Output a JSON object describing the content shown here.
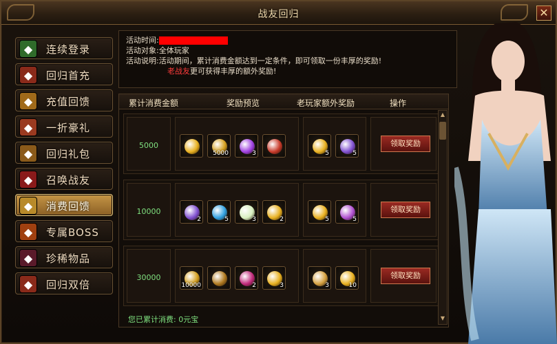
{
  "window": {
    "title": "战友回归",
    "close_label": "✕"
  },
  "sidebar": {
    "items": [
      {
        "label": "连续登录",
        "icon": "tree-icon",
        "color": "#2f6b2a"
      },
      {
        "label": "回归首充",
        "icon": "chest-icon",
        "color": "#8a2a1a"
      },
      {
        "label": "充值回馈",
        "icon": "gold-bag-icon",
        "color": "#a06a1a"
      },
      {
        "label": "一折豪礼",
        "icon": "gift-icon",
        "color": "#9a3a20"
      },
      {
        "label": "回归礼包",
        "icon": "treasure-icon",
        "color": "#8a5a1a"
      },
      {
        "label": "召唤战友",
        "icon": "banner-icon",
        "color": "#8a1a1a"
      },
      {
        "label": "消费回馈",
        "icon": "gold-ingot-icon",
        "color": "#b88a2a",
        "active": true
      },
      {
        "label": "专属BOSS",
        "icon": "boss-icon",
        "color": "#a04010"
      },
      {
        "label": "珍稀物品",
        "icon": "helmet-icon",
        "color": "#5a1a2a"
      },
      {
        "label": "回归双倍",
        "icon": "double-icon",
        "color": "#8a2a1a"
      }
    ]
  },
  "info": {
    "time_label": "活动时间:",
    "target_label": "活动对象:",
    "target_value": "全体玩家",
    "desc_label": "活动说明:",
    "desc_line1": "活动期间，累计消费金额达到一定条件，即可领取一份丰厚的奖励!",
    "desc_highlight": "老战友",
    "desc_line2": "更可获得丰厚的额外奖励!"
  },
  "table": {
    "headers": [
      "累计消费金额",
      "奖励预览",
      "老玩家额外奖励",
      "操作"
    ],
    "rows": [
      {
        "amount": "5000",
        "rewards": [
          {
            "icon": "gold-orb-icon",
            "qty": "",
            "color": "#e8b020"
          },
          {
            "icon": "gold-ingot-icon",
            "qty": "5000",
            "color": "#d4a020"
          },
          {
            "icon": "purple-orb-icon",
            "qty": "3",
            "color": "#a040e0"
          },
          {
            "icon": "treasure-chest-icon",
            "qty": "",
            "color": "#c83a2a"
          }
        ],
        "extra": [
          {
            "icon": "gold-orb-icon",
            "qty": "5",
            "color": "#e8b020"
          },
          {
            "icon": "purple-scroll-icon",
            "qty": "5",
            "color": "#8050d0"
          }
        ],
        "button": "领取奖励"
      },
      {
        "amount": "10000",
        "rewards": [
          {
            "icon": "purple-scroll-icon",
            "qty": "2",
            "color": "#8050d0"
          },
          {
            "icon": "blue-wing-icon",
            "qty": "5",
            "color": "#30a0e0"
          },
          {
            "icon": "white-orb-icon",
            "qty": "3",
            "color": "#d8f0c0"
          },
          {
            "icon": "gold-orb-icon",
            "qty": "2",
            "color": "#e8b020"
          }
        ],
        "extra": [
          {
            "icon": "gold-orb-icon",
            "qty": "5",
            "color": "#e8b020"
          },
          {
            "icon": "purple-gem-icon",
            "qty": "5",
            "color": "#b050d0"
          }
        ],
        "button": "领取奖励"
      },
      {
        "amount": "30000",
        "rewards": [
          {
            "icon": "gold-ingot-icon",
            "qty": "10000",
            "color": "#d4a020"
          },
          {
            "icon": "gold-coin-icon",
            "qty": "",
            "color": "#b07a20"
          },
          {
            "icon": "pink-orb-icon",
            "qty": "2",
            "color": "#c02a7a"
          },
          {
            "icon": "gold-orb-icon",
            "qty": "3",
            "color": "#e8b020"
          }
        ],
        "extra": [
          {
            "icon": "gold-bars-icon",
            "qty": "3",
            "color": "#d4a040"
          },
          {
            "icon": "gold-orb-icon",
            "qty": "10",
            "color": "#e8b020"
          }
        ],
        "button": "领取奖励"
      }
    ]
  },
  "footer": {
    "total_label": "您已累计消费:",
    "total_value": "0元宝"
  }
}
